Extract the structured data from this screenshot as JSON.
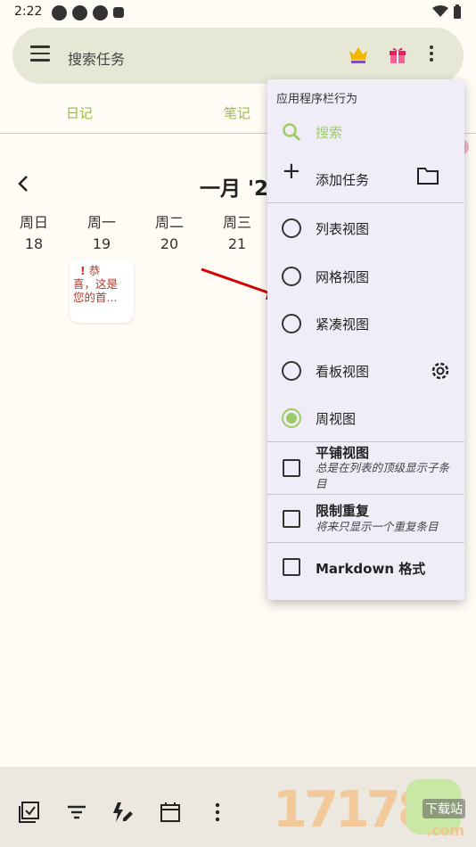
{
  "status_bar": {
    "time": "2:22"
  },
  "search": {
    "placeholder": "搜索任务"
  },
  "tabs": [
    {
      "label": "日记"
    },
    {
      "label": "笔记"
    }
  ],
  "calendar": {
    "month": "一月 '2",
    "days": [
      {
        "name": "周日",
        "date": "18"
      },
      {
        "name": "周一",
        "date": "19"
      },
      {
        "name": "周二",
        "date": "20"
      },
      {
        "name": "周三",
        "date": "21"
      }
    ],
    "task": {
      "mark": "!",
      "line1": "恭",
      "line2": "喜，这是",
      "line3": "您的首..."
    }
  },
  "popup_menu": {
    "title": "应用程序栏行为",
    "search_label": "搜索",
    "add_task_label": "添加任务",
    "views": [
      {
        "label": "列表视图",
        "selected": false
      },
      {
        "label": "网格视图",
        "selected": false
      },
      {
        "label": "紧凑视图",
        "selected": false
      },
      {
        "label": "看板视图",
        "selected": false
      },
      {
        "label": "周视图",
        "selected": true
      }
    ],
    "options": [
      {
        "label": "平铺视图",
        "description": "总是在列表的顶级显示子条目",
        "checked": false
      },
      {
        "label": "限制重复",
        "description": "将来只显示一个重复条目",
        "checked": false
      },
      {
        "label": "Markdown 格式",
        "description": "",
        "checked": false
      }
    ]
  },
  "colors": {
    "accent": "#9ccc65",
    "tab_text": "#9aba4c",
    "background": "#fffcf5"
  },
  "watermark": {
    "big": "17178",
    "small": "下载站",
    "domain": ".com"
  }
}
